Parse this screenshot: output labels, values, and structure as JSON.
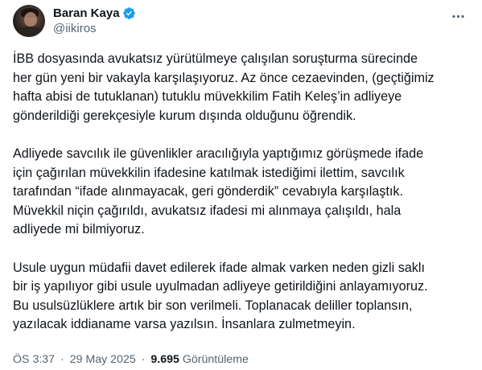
{
  "author": {
    "display_name": "Baran Kaya",
    "handle": "@iikiros",
    "verified_color": "#1d9bf0"
  },
  "icons": {
    "verified": "verified-badge-icon",
    "more": "more-options-icon"
  },
  "tweet": {
    "paragraphs": [
      "İBB dosyasında avukatsız yürütülmeye çalışılan soruşturma sürecinde\nher gün yeni bir vakayla karşılaşıyoruz. Az önce cezaevinden, (geçtiğimiz\nhafta abisi de tutuklanan) tutuklu müvekkilim Fatih Keleş’in adliyeye\ngönderildiği gerekçesiyle kurum dışında olduğunu öğrendik.",
      "Adliyede savcılık ile güvenlikler aracılığıyla yaptığımız görüşmede ifade\niçin çağırılan müvekkilin ifadesine katılmak istediğimi ilettim, savcılık\ntarafından “ifade alınmayacak, geri gönderdik” cevabıyla karşılaştık.\nMüvekkil niçin çağırıldı, avukatsız ifadesi mi alınmaya çalışıldı, hala\nadliyede mi bilmiyoruz.",
      "Usule uygun müdafii davet edilerek ifade almak varken neden gizli saklı\nbir iş yapılıyor gibi usule uyulmadan adliyeye getirildiğini anlayamıyoruz.\nBu usulsüzlüklere artık bir son verilmeli. Toplanacak deliller toplansın,\nyazılacak iddianame varsa yazılsın. İnsanlara zulmetmeyin."
    ]
  },
  "meta": {
    "time": "ÖS 3:37",
    "separator": "·",
    "date": "29 May 2025",
    "views_count": "9.695",
    "views_label": "Görüntüleme"
  }
}
